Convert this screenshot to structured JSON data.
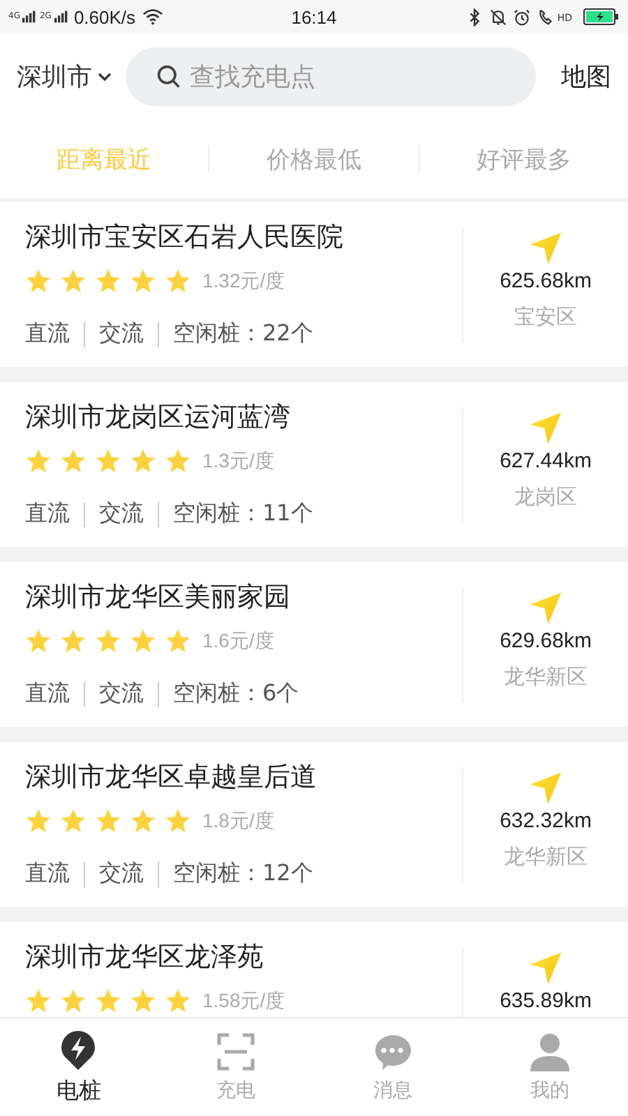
{
  "status_bar": {
    "network_1": "4G",
    "network_2": "2G",
    "speed": "0.60K/s",
    "time": "16:14",
    "call_badge": "HD"
  },
  "header": {
    "city": "深圳市",
    "search": {
      "placeholder": "查找充电点"
    },
    "map_link": "地图"
  },
  "sort_tabs": [
    {
      "label": "距离最近",
      "selected": true
    },
    {
      "label": "价格最低",
      "selected": false
    },
    {
      "label": "好评最多",
      "selected": false
    }
  ],
  "stations": [
    {
      "name": "深圳市宝安区石岩人民医院",
      "stars": 5,
      "price": "1.32元/度",
      "tags": [
        "直流",
        "交流",
        "空闲桩：22个"
      ],
      "distance": "625.68km",
      "district": "宝安区"
    },
    {
      "name": "深圳市龙岗区运河蓝湾",
      "stars": 5,
      "price": "1.3元/度",
      "tags": [
        "直流",
        "交流",
        "空闲桩：11个"
      ],
      "distance": "627.44km",
      "district": "龙岗区"
    },
    {
      "name": "深圳市龙华区美丽家园",
      "stars": 5,
      "price": "1.6元/度",
      "tags": [
        "直流",
        "交流",
        "空闲桩：6个"
      ],
      "distance": "629.68km",
      "district": "龙华新区"
    },
    {
      "name": "深圳市龙华区卓越皇后道",
      "stars": 5,
      "price": "1.8元/度",
      "tags": [
        "直流",
        "交流",
        "空闲桩：12个"
      ],
      "distance": "632.32km",
      "district": "龙华新区"
    },
    {
      "name": "深圳市龙华区龙泽苑",
      "stars": 5,
      "price": "1.58元/度",
      "distance": "635.89km"
    }
  ],
  "bottom_nav": [
    {
      "label": "电桩",
      "selected": true
    },
    {
      "label": "充电",
      "selected": false
    },
    {
      "label": "消息",
      "selected": false
    },
    {
      "label": "我的",
      "selected": false
    }
  ]
}
